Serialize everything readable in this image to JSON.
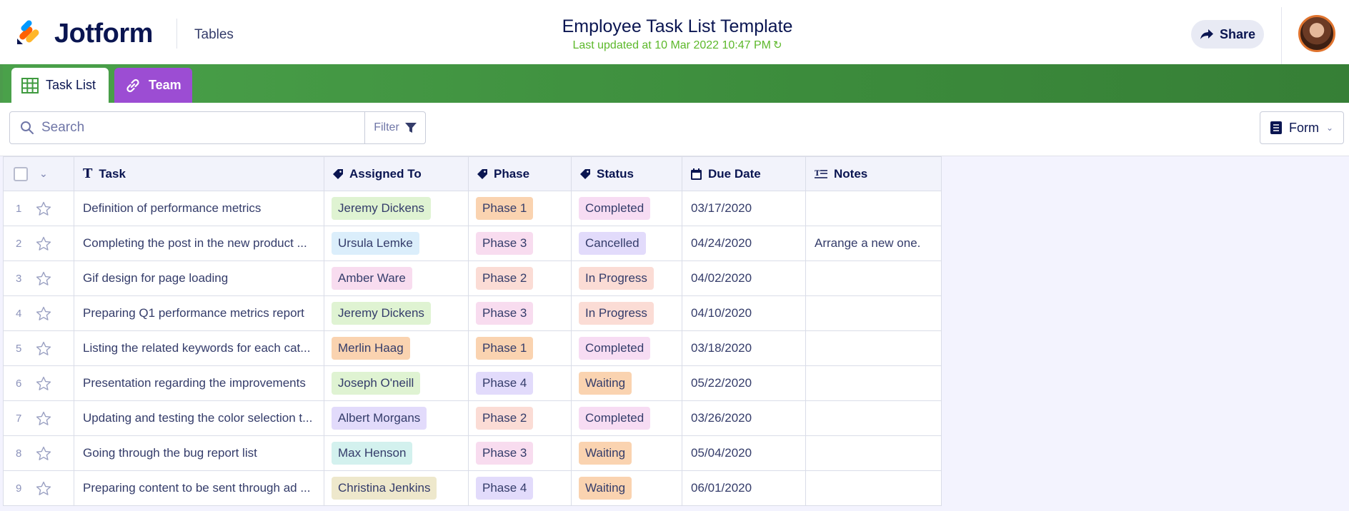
{
  "header": {
    "brand": "Jotform",
    "section_link": "Tables",
    "title": "Employee Task List Template",
    "last_updated": "Last updated at 10 Mar 2022 10:47 PM",
    "share_label": "Share"
  },
  "tabs": [
    {
      "label": "Task List",
      "icon": "grid-table-icon",
      "active": true
    },
    {
      "label": "Team",
      "icon": "link-icon",
      "active": false,
      "color": "#9c4dd3"
    }
  ],
  "toolbar": {
    "search_placeholder": "Search",
    "filter_label": "Filter",
    "form_label": "Form"
  },
  "table": {
    "columns": [
      {
        "label": "Task",
        "icon": "text-type-icon"
      },
      {
        "label": "Assigned To",
        "icon": "tag-icon"
      },
      {
        "label": "Phase",
        "icon": "tag-icon"
      },
      {
        "label": "Status",
        "icon": "tag-icon"
      },
      {
        "label": "Due Date",
        "icon": "calendar-icon"
      },
      {
        "label": "Notes",
        "icon": "long-text-icon"
      }
    ],
    "rows": [
      {
        "num": "1",
        "task": "Definition of performance metrics",
        "assigned": "Jeremy Dickens",
        "assigned_color": "#dff3d2",
        "phase": "Phase 1",
        "phase_color": "#fad3b0",
        "status": "Completed",
        "status_color": "#f7dcf3",
        "due": "03/17/2020",
        "notes": ""
      },
      {
        "num": "2",
        "task": "Completing the post in the new product ...",
        "assigned": "Ursula Lemke",
        "assigned_color": "#dbeefb",
        "phase": "Phase 3",
        "phase_color": "#f8dcef",
        "status": "Cancelled",
        "status_color": "#e2dbfb",
        "due": "04/24/2020",
        "notes": "Arrange a new one."
      },
      {
        "num": "3",
        "task": "Gif design for page loading",
        "assigned": "Amber Ware",
        "assigned_color": "#f8dcef",
        "phase": "Phase 2",
        "phase_color": "#fbdcd5",
        "status": "In Progress",
        "status_color": "#fbdcd5",
        "due": "04/02/2020",
        "notes": ""
      },
      {
        "num": "4",
        "task": "Preparing Q1 performance metrics report",
        "assigned": "Jeremy Dickens",
        "assigned_color": "#dff3d2",
        "phase": "Phase 3",
        "phase_color": "#f8dcef",
        "status": "In Progress",
        "status_color": "#fbdcd5",
        "due": "04/10/2020",
        "notes": ""
      },
      {
        "num": "5",
        "task": "Listing the related keywords for each cat...",
        "assigned": "Merlin Haag",
        "assigned_color": "#fad3b0",
        "phase": "Phase 1",
        "phase_color": "#fad3b0",
        "status": "Completed",
        "status_color": "#f7dcf3",
        "due": "03/18/2020",
        "notes": ""
      },
      {
        "num": "6",
        "task": "Presentation regarding the improvements",
        "assigned": "Joseph O'neill",
        "assigned_color": "#dff3d2",
        "phase": "Phase 4",
        "phase_color": "#e2dbfb",
        "status": "Waiting",
        "status_color": "#fad3b0",
        "due": "05/22/2020",
        "notes": ""
      },
      {
        "num": "7",
        "task": "Updating and testing the color selection t...",
        "assigned": "Albert Morgans",
        "assigned_color": "#e2dbfb",
        "phase": "Phase 2",
        "phase_color": "#fbdcd5",
        "status": "Completed",
        "status_color": "#f7dcf3",
        "due": "03/26/2020",
        "notes": ""
      },
      {
        "num": "8",
        "task": "Going through the bug report list",
        "assigned": "Max Henson",
        "assigned_color": "#d3f1ee",
        "phase": "Phase 3",
        "phase_color": "#f8dcef",
        "status": "Waiting",
        "status_color": "#fad3b0",
        "due": "05/04/2020",
        "notes": ""
      },
      {
        "num": "9",
        "task": "Preparing content to be sent through ad ...",
        "assigned": "Christina Jenkins",
        "assigned_color": "#eee8cc",
        "phase": "Phase 4",
        "phase_color": "#e2dbfb",
        "status": "Waiting",
        "status_color": "#fad3b0",
        "due": "06/01/2020",
        "notes": ""
      }
    ]
  }
}
